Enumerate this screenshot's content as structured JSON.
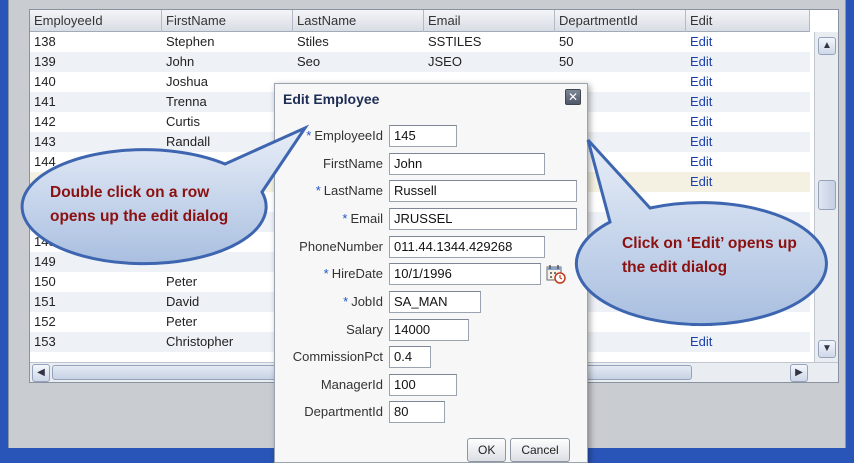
{
  "table": {
    "columns": [
      "EmployeeId",
      "FirstName",
      "LastName",
      "Email",
      "DepartmentId",
      "Edit"
    ],
    "rows": [
      [
        "138",
        "Stephen",
        "Stiles",
        "SSTILES",
        "50",
        "Edit"
      ],
      [
        "139",
        "John",
        "Seo",
        "JSEO",
        "50",
        "Edit"
      ],
      [
        "140",
        "Joshua",
        "",
        "",
        "",
        "Edit"
      ],
      [
        "141",
        "Trenna",
        "",
        "",
        "",
        "Edit"
      ],
      [
        "142",
        "Curtis",
        "",
        "",
        "",
        "Edit"
      ],
      [
        "143",
        "Randall",
        "",
        "",
        "",
        "Edit"
      ],
      [
        "144",
        "",
        "",
        "",
        "",
        "Edit"
      ],
      [
        "",
        "",
        "",
        "",
        "",
        "Edit"
      ],
      [
        "",
        "",
        "",
        "",
        "",
        ""
      ],
      [
        "",
        "",
        "",
        "",
        "",
        ""
      ],
      [
        "148",
        "",
        "",
        "",
        "",
        ""
      ],
      [
        "149",
        "",
        "",
        "",
        "",
        ""
      ],
      [
        "150",
        "Peter",
        "",
        "",
        "",
        "Edit"
      ],
      [
        "151",
        "David",
        "",
        "",
        "",
        "Edit"
      ],
      [
        "152",
        "Peter",
        "",
        "",
        "",
        "Edit"
      ],
      [
        "153",
        "Christopher",
        "",
        "",
        "",
        "Edit"
      ]
    ]
  },
  "dialog": {
    "title": "Edit Employee",
    "fields": [
      {
        "label": "EmployeeId",
        "required": true,
        "value": "145"
      },
      {
        "label": "FirstName",
        "required": false,
        "value": "John"
      },
      {
        "label": "LastName",
        "required": true,
        "value": "Russell"
      },
      {
        "label": "Email",
        "required": true,
        "value": "JRUSSEL"
      },
      {
        "label": "PhoneNumber",
        "required": false,
        "value": "011.44.1344.429268"
      },
      {
        "label": "HireDate",
        "required": true,
        "value": "10/1/1996"
      },
      {
        "label": "JobId",
        "required": true,
        "value": "SA_MAN"
      },
      {
        "label": "Salary",
        "required": false,
        "value": "14000"
      },
      {
        "label": "CommissionPct",
        "required": false,
        "value": "0.4"
      },
      {
        "label": "ManagerId",
        "required": false,
        "value": "100"
      },
      {
        "label": "DepartmentId",
        "required": false,
        "value": "80"
      }
    ],
    "ok_label": "OK",
    "cancel_label": "Cancel"
  },
  "callouts": {
    "left_line1": "Double click on a row",
    "left_line2": "opens up the edit  dialog",
    "right_line1": "Click on ‘Edit’ opens up",
    "right_line2": "the edit  dialog"
  },
  "colors": {
    "callout_text": "#8b1010",
    "required_marker": "#1e55c8",
    "link": "#1a3fa8"
  },
  "icons": {
    "close": "close-icon",
    "calendar": "calendar-icon",
    "scroll_up": "scroll-up-icon",
    "scroll_down": "scroll-down-icon",
    "scroll_left": "scroll-left-icon",
    "scroll_right": "scroll-right-icon"
  }
}
